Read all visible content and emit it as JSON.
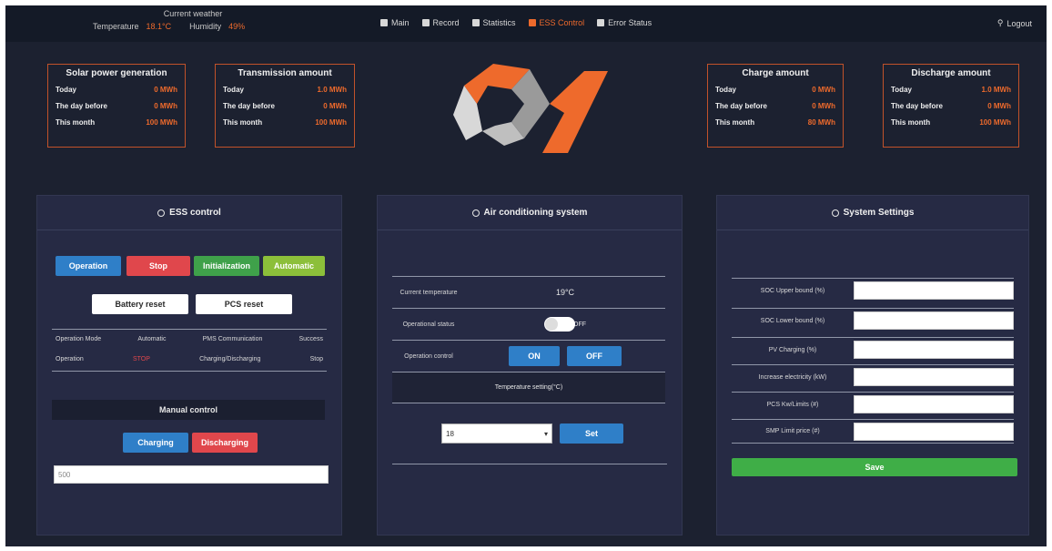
{
  "weather": {
    "title": "Current weather",
    "temperature_label": "Temperature",
    "temperature_value": "18.1°C",
    "humidity_label": "Humidity",
    "humidity_value": "49%"
  },
  "nav": {
    "items": [
      {
        "label": "Main",
        "icon": "home-icon"
      },
      {
        "label": "Record",
        "icon": "monitor-icon"
      },
      {
        "label": "Statistics",
        "icon": "chart-icon"
      },
      {
        "label": "ESS Control",
        "icon": "control-icon"
      },
      {
        "label": "Error Status",
        "icon": "list-icon"
      }
    ],
    "logout": "Logout"
  },
  "stats": [
    {
      "title": "Solar power generation",
      "rows": [
        {
          "label": "Today",
          "value": "0 MWh"
        },
        {
          "label": "The day before",
          "value": "0 MWh"
        },
        {
          "label": "This month",
          "value": "100 MWh"
        }
      ]
    },
    {
      "title": "Transmission amount",
      "rows": [
        {
          "label": "Today",
          "value": "1.0 MWh"
        },
        {
          "label": "The day before",
          "value": "0 MWh"
        },
        {
          "label": "This month",
          "value": "100 MWh"
        }
      ]
    },
    {
      "title": "Charge amount",
      "rows": [
        {
          "label": "Today",
          "value": "0 MWh"
        },
        {
          "label": "The day before",
          "value": "0 MWh"
        },
        {
          "label": "This month",
          "value": "80 MWh"
        }
      ]
    },
    {
      "title": "Discharge amount",
      "rows": [
        {
          "label": "Today",
          "value": "1.0 MWh"
        },
        {
          "label": "The day before",
          "value": "0 MWh"
        },
        {
          "label": "This month",
          "value": "100 MWh"
        }
      ]
    }
  ],
  "colors": {
    "accent": "#ee6a2c",
    "panel": "#262a44",
    "background": "#1c2130"
  },
  "ess": {
    "title": "ESS control",
    "buttons": {
      "operation": "Operation",
      "stop": "Stop",
      "initialization": "Initialization",
      "automatic": "Automatic"
    },
    "reset": {
      "battery": "Battery reset",
      "pcs": "PCS reset"
    },
    "status_rows": [
      [
        "Operation Mode",
        "Automatic",
        "PMS Communication",
        "Success"
      ],
      [
        "Operation",
        "STOP",
        "Charging/Discharging",
        "Stop"
      ]
    ],
    "manual": {
      "title": "Manual control",
      "charging": "Charging",
      "discharging": "Discharging",
      "input_value": "500"
    }
  },
  "ac": {
    "title": "Air conditioning system",
    "rows": {
      "current_temp_label": "Current temperature",
      "current_temp_value": "19°C",
      "op_status_label": "Operational status",
      "op_status_value": "OFF",
      "op_control_label": "Operation control",
      "on": "ON",
      "off": "OFF",
      "setting_label": "Temperature setting(°C)"
    },
    "select_value": "18",
    "set": "Set"
  },
  "settings": {
    "title": "System Settings",
    "fields": [
      "SOC Upper bound (%)",
      "SOC Lower bound (%)",
      "PV Charging (%)",
      "Increase electricity (kW)",
      "PCS Kw/Limits (#)",
      "SMP Limit price (#)"
    ],
    "save": "Save"
  }
}
